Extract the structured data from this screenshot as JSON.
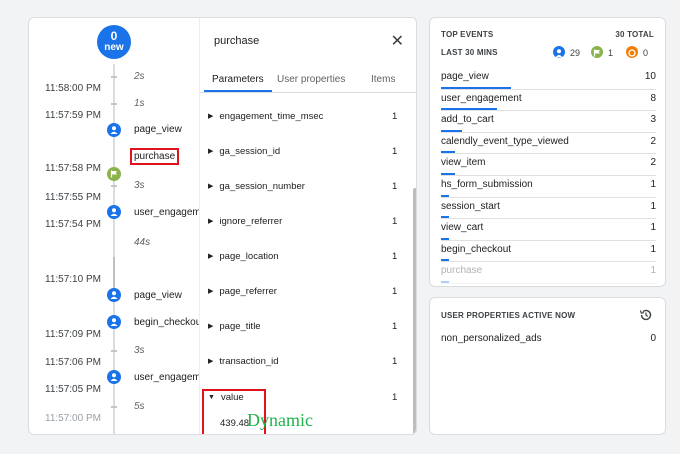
{
  "timeline": {
    "new_count": "0",
    "new_label": "new",
    "times": [
      "11:58:00 PM",
      "11:57:59 PM",
      "11:57:58 PM",
      "11:57:55 PM",
      "11:57:54 PM",
      "11:57:10 PM",
      "11:57:09 PM",
      "11:57:06 PM",
      "11:57:05 PM",
      "11:57:00 PM"
    ],
    "durations": [
      "2s",
      "1s",
      "3s",
      "44s",
      "3s",
      "5s"
    ],
    "events": [
      "page_view",
      "purchase",
      "user_engagement",
      "page_view",
      "begin_checkout",
      "user_engagement"
    ]
  },
  "detail": {
    "title": "purchase",
    "close": "✕",
    "tabs": [
      "Parameters",
      "User properties",
      "Items"
    ],
    "params": [
      {
        "name": "engagement_time_msec",
        "count": "1"
      },
      {
        "name": "ga_session_id",
        "count": "1"
      },
      {
        "name": "ga_session_number",
        "count": "1"
      },
      {
        "name": "ignore_referrer",
        "count": "1"
      },
      {
        "name": "page_location",
        "count": "1"
      },
      {
        "name": "page_referrer",
        "count": "1"
      },
      {
        "name": "page_title",
        "count": "1"
      },
      {
        "name": "transaction_id",
        "count": "1"
      },
      {
        "name": "value",
        "count": "1"
      }
    ],
    "value_value": "439.48",
    "annotation": "Dynamic"
  },
  "top_events": {
    "title": "TOP EVENTS",
    "total": "30 TOTAL",
    "period": "LAST 30 MINS",
    "legend": [
      {
        "icon": "user-icon",
        "count": "29",
        "color": "#1a73e8"
      },
      {
        "icon": "flag-icon",
        "count": "1",
        "color": "#8ab34b"
      },
      {
        "icon": "error-icon",
        "count": "0",
        "color": "#f57c00"
      }
    ],
    "rows": [
      {
        "name": "page_view",
        "count": "10",
        "share": 1.0
      },
      {
        "name": "user_engagement",
        "count": "8",
        "share": 0.8
      },
      {
        "name": "add_to_cart",
        "count": "3",
        "share": 0.3
      },
      {
        "name": "calendly_event_type_viewed",
        "count": "2",
        "share": 0.2
      },
      {
        "name": "view_item",
        "count": "2",
        "share": 0.2
      },
      {
        "name": "hs_form_submission",
        "count": "1",
        "share": 0.1
      },
      {
        "name": "session_start",
        "count": "1",
        "share": 0.1
      },
      {
        "name": "view_cart",
        "count": "1",
        "share": 0.1
      },
      {
        "name": "begin_checkout",
        "count": "1",
        "share": 0.1
      },
      {
        "name": "purchase",
        "count": "1",
        "share": 0.1
      }
    ]
  },
  "user_props": {
    "title": "USER PROPERTIES ACTIVE NOW",
    "rows": [
      {
        "name": "non_personalized_ads",
        "count": "0"
      }
    ]
  }
}
